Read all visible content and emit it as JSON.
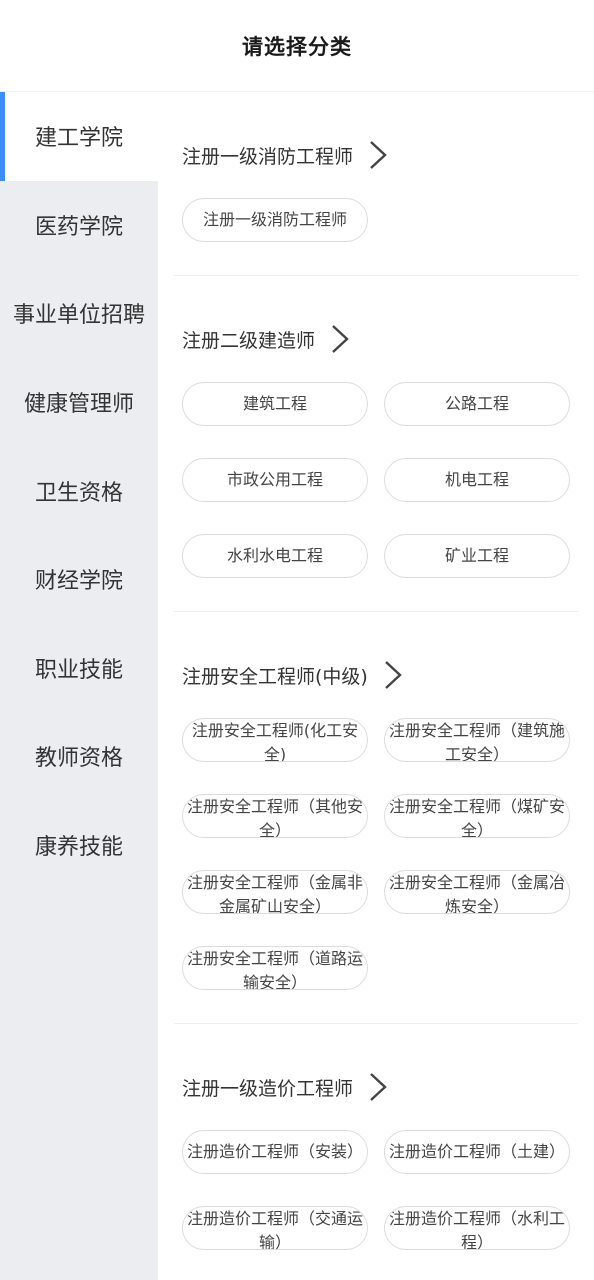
{
  "header": {
    "title": "请选择分类"
  },
  "sidebar": {
    "items": [
      {
        "label": "建工学院",
        "active": true
      },
      {
        "label": "医药学院",
        "active": false
      },
      {
        "label": "事业单位招聘",
        "active": false
      },
      {
        "label": "健康管理师",
        "active": false
      },
      {
        "label": "卫生资格",
        "active": false
      },
      {
        "label": "财经学院",
        "active": false
      },
      {
        "label": "职业技能",
        "active": false
      },
      {
        "label": "教师资格",
        "active": false
      },
      {
        "label": "康养技能",
        "active": false
      }
    ],
    "accent_color": "#3f8cf6",
    "background": "#ebedf1"
  },
  "sections": [
    {
      "title": "注册一级消防工程师",
      "chips": [
        "注册一级消防工程师"
      ]
    },
    {
      "title": "注册二级建造师",
      "chips": [
        "建筑工程",
        "公路工程",
        "市政公用工程",
        "机电工程",
        "水利水电工程",
        "矿业工程"
      ]
    },
    {
      "title": "注册安全工程师(中级)",
      "chips": [
        "注册安全工程师(化工安全)",
        "注册安全工程师（建筑施工安全）",
        "注册安全工程师（其他安全）",
        "注册安全工程师（煤矿安全）",
        "注册安全工程师（金属非金属矿山安全）",
        "注册安全工程师（金属冶炼安全）",
        "注册安全工程师（道路运输安全）"
      ]
    },
    {
      "title": "注册一级造价工程师",
      "chips": [
        "注册造价工程师（安装）",
        "注册造价工程师（土建）",
        "注册造价工程师（交通运输）",
        "注册造价工程师（水利工程）"
      ]
    }
  ]
}
